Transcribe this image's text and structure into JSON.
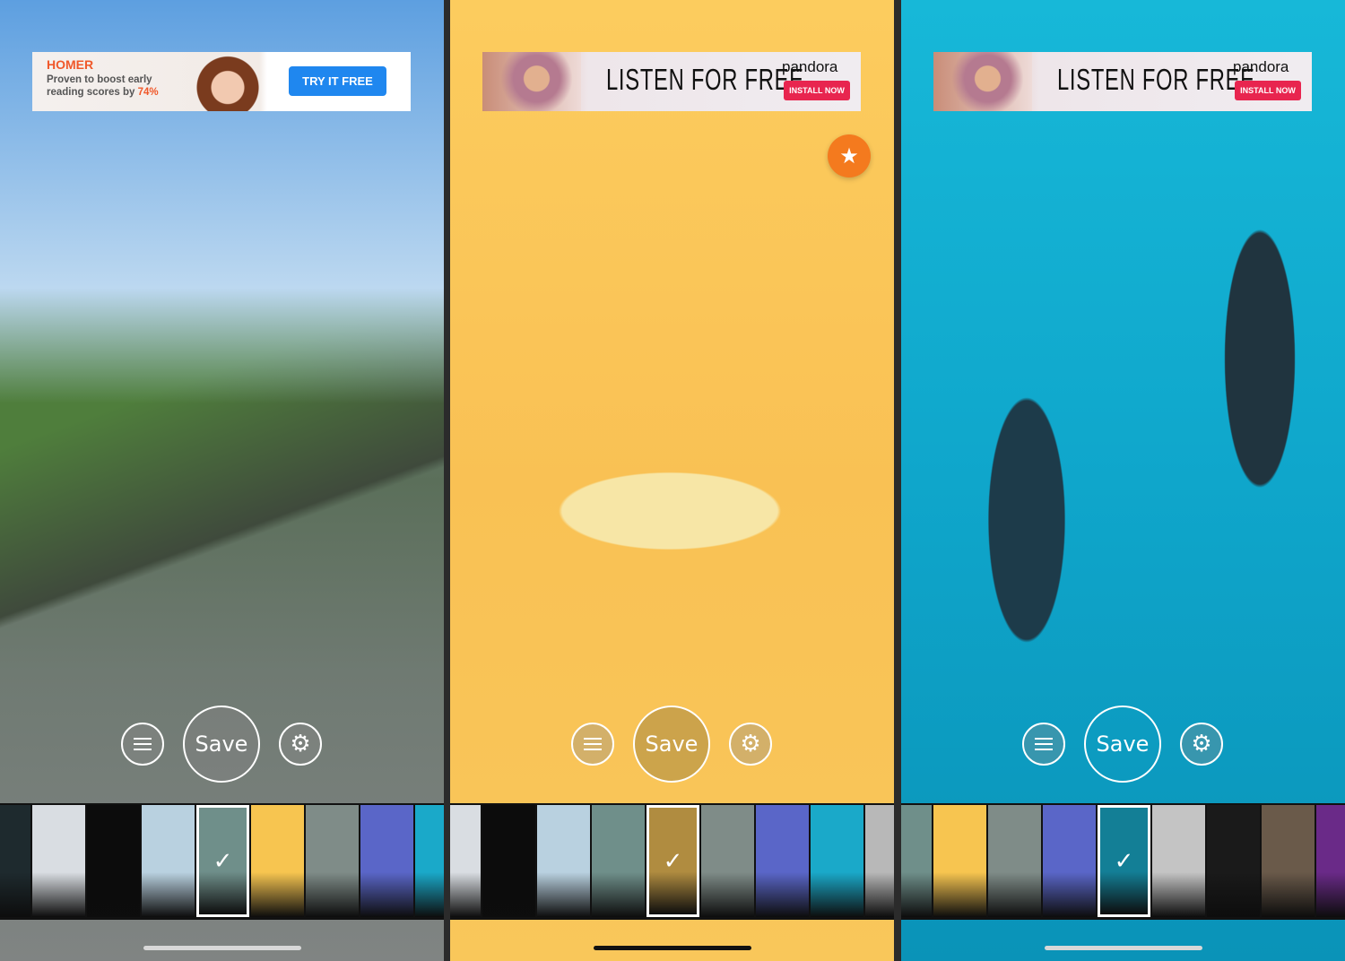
{
  "panels": [
    {
      "background": [
        "#5d9fe0",
        "#bcd8f0",
        "#4f7e3c",
        "#6f7a72"
      ],
      "ad": {
        "type": "homer",
        "brand": "HOMER",
        "text": "Proven to boost early reading scores by",
        "highlight": "74%",
        "button": "TRY IT FREE"
      },
      "save_label": "Save",
      "save_fill": "rgba(130,130,130,0.45)",
      "home_indicator": "#d8d8d8",
      "selected_thumb": 4,
      "thumbs": [
        "#1e2a2e",
        "#d9dde2",
        "#0c0c0c",
        "#b9d1e0",
        "#6f8f8a",
        "#f7c550",
        "#7f8c88",
        "#5a66c8",
        "#1aa9c9"
      ]
    },
    {
      "background": [
        "#fccc5e",
        "#f9c154",
        "#f6b84a",
        "#f9c75a"
      ],
      "ad": {
        "type": "pandora",
        "headline": "LISTEN FOR FREE",
        "brand": "pandora",
        "button": "INSTALL NOW"
      },
      "favorite_icon": "star-icon",
      "save_label": "Save",
      "save_fill": "rgba(185,150,70,0.7)",
      "home_indicator": "#111111",
      "selected_thumb": 4,
      "thumbs": [
        "#d9dde2",
        "#0c0c0c",
        "#b9d1e0",
        "#6f8f8a",
        "#b08c40",
        "#7f8c88",
        "#5a66c8",
        "#1aa9c9",
        "#b8b8b8"
      ]
    },
    {
      "background": [
        "#17b8d8",
        "#0fa6cb",
        "#0a93b8",
        "#14a9cc"
      ],
      "ad": {
        "type": "pandora",
        "headline": "LISTEN FOR FREE",
        "brand": "pandora",
        "button": "INSTALL NOW"
      },
      "save_label": "Save",
      "save_fill": "rgba(0,0,0,0)",
      "home_indicator": "#d8d8d8",
      "selected_thumb": 4,
      "thumbs": [
        "#6f8f8a",
        "#f7c550",
        "#7f8c88",
        "#5a66c8",
        "#137f96",
        "#c4c4c4",
        "#1a1a1a",
        "#6a5a4a",
        "#6a2a88"
      ]
    }
  ]
}
